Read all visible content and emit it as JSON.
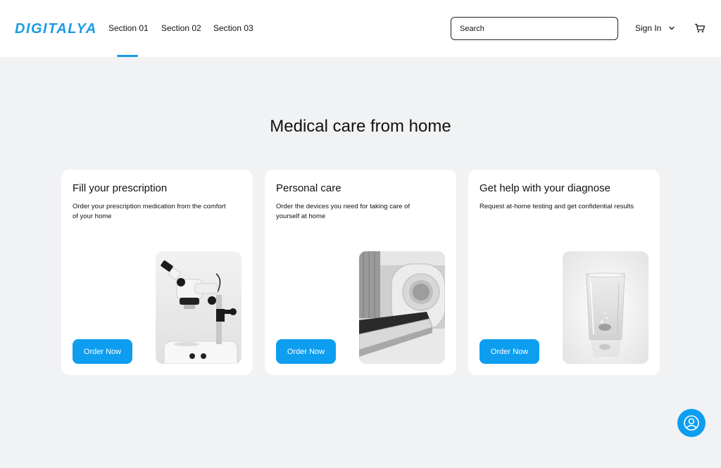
{
  "header": {
    "logo": "DIGITALYA",
    "nav": [
      {
        "label": "Section 01",
        "active": true
      },
      {
        "label": "Section 02",
        "active": false
      },
      {
        "label": "Section 03",
        "active": false
      }
    ],
    "search_placeholder": "Search",
    "signin_label": "Sign In",
    "icons": {
      "signin_menu": "chevron-down-icon",
      "cart": "cart-icon"
    }
  },
  "main": {
    "headline": "Medical care from home",
    "cards": [
      {
        "title": "Fill your prescription",
        "description": "Order your prescription medication from the comfort of your home",
        "button": "Order Now",
        "image": "microscope-image"
      },
      {
        "title": "Personal care",
        "description": "Order the devices you need for taking care of yourself at home",
        "button": "Order Now",
        "image": "mri-scanner-image"
      },
      {
        "title": "Get help with your diagnose",
        "description": "Request at-home testing and get confidential results",
        "button": "Order Now",
        "image": "glass-of-water-image"
      }
    ]
  },
  "fab": {
    "icon": "user-account-icon"
  },
  "colors": {
    "accent": "#0d9ef0",
    "logo": "#1a9be6",
    "background": "#f1f2f4",
    "card": "#ffffff"
  }
}
